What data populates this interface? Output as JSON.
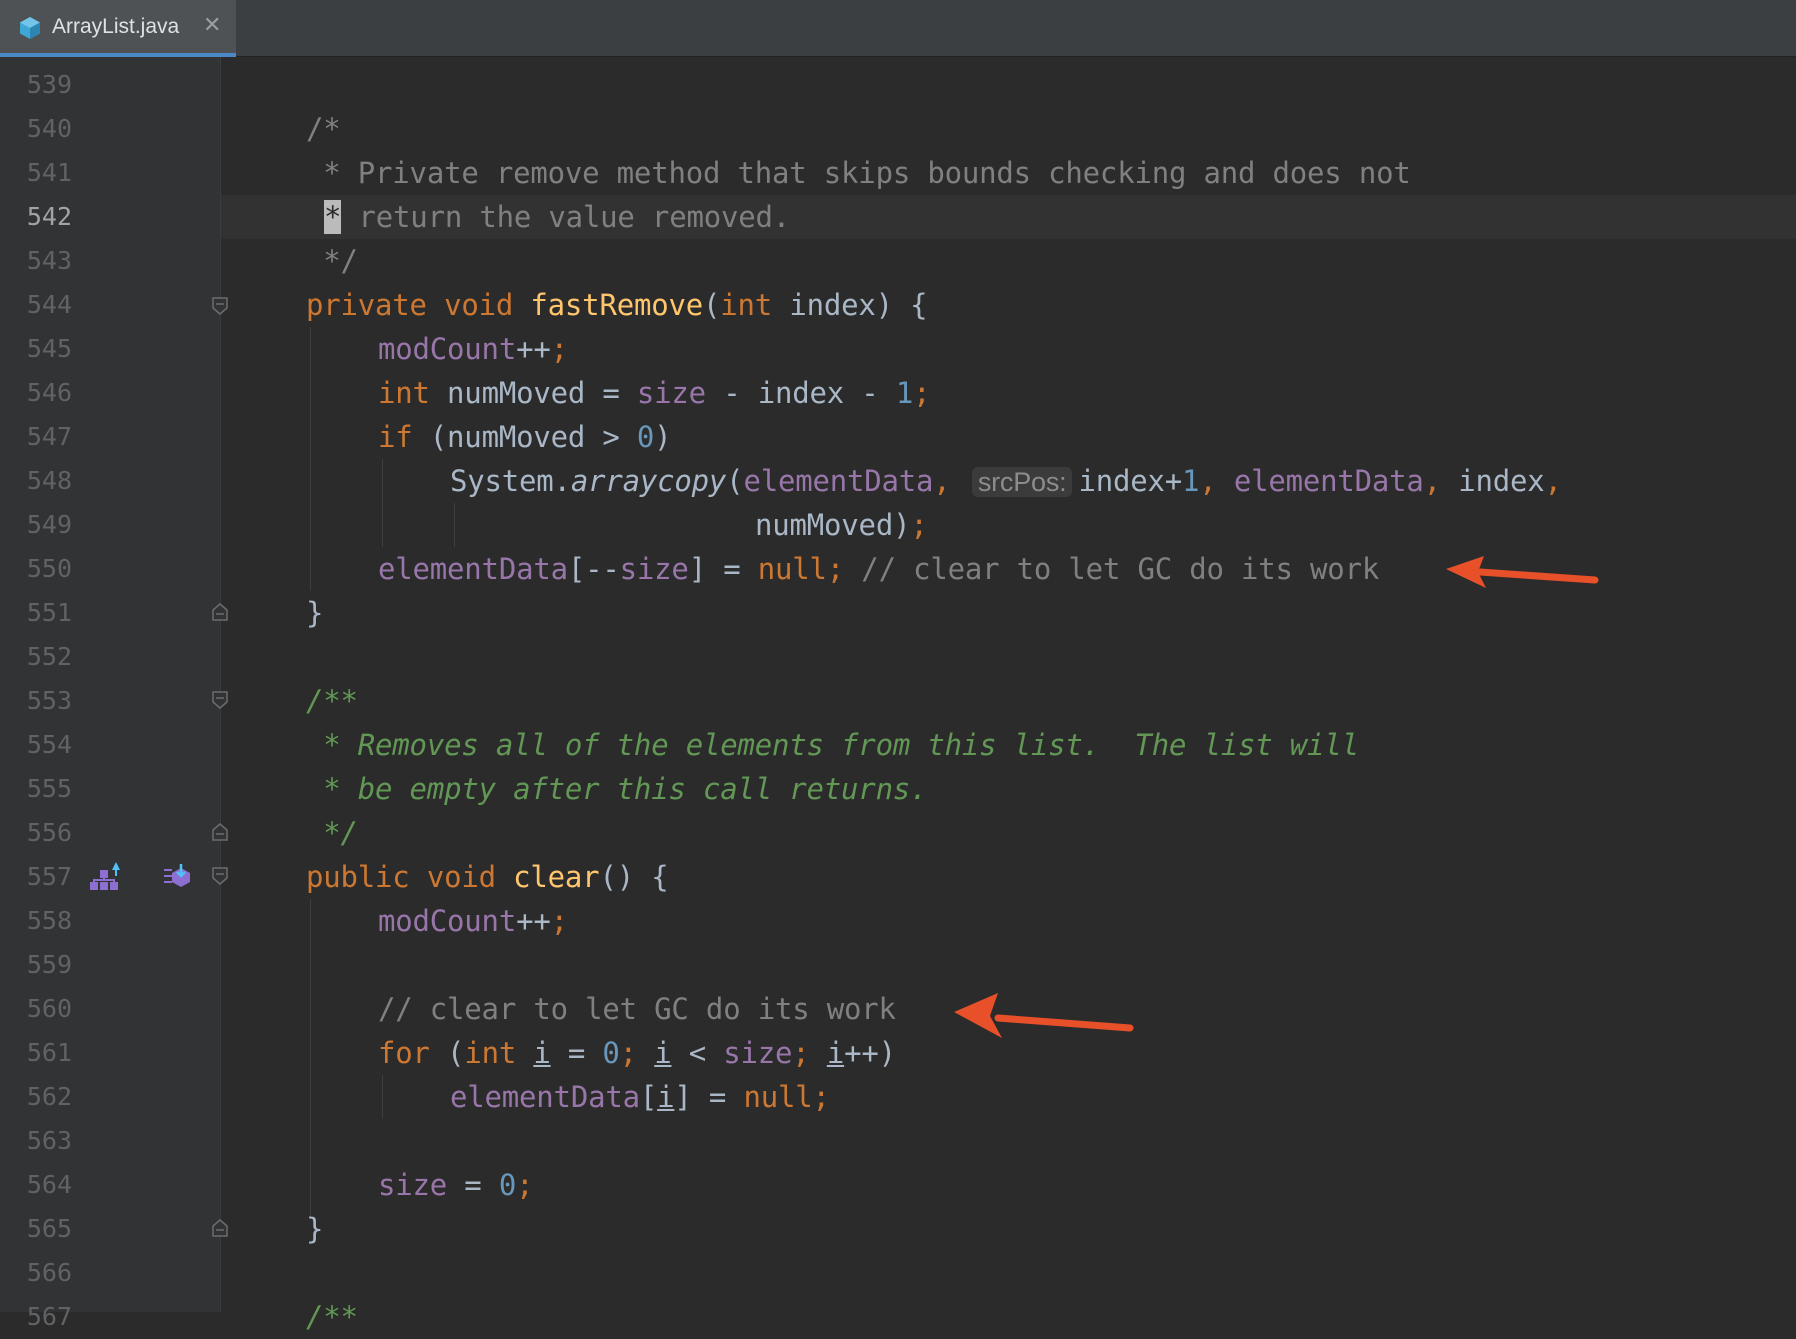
{
  "tab": {
    "title": "ArrayList.java",
    "close": "✕",
    "icon": "java-class-icon"
  },
  "lines": [
    {
      "n": "539",
      "current": false
    },
    {
      "n": "540",
      "current": false
    },
    {
      "n": "541",
      "current": false
    },
    {
      "n": "542",
      "current": true
    },
    {
      "n": "543",
      "current": false
    },
    {
      "n": "544",
      "current": false
    },
    {
      "n": "545",
      "current": false
    },
    {
      "n": "546",
      "current": false
    },
    {
      "n": "547",
      "current": false
    },
    {
      "n": "548",
      "current": false
    },
    {
      "n": "549",
      "current": false
    },
    {
      "n": "550",
      "current": false
    },
    {
      "n": "551",
      "current": false
    },
    {
      "n": "552",
      "current": false
    },
    {
      "n": "553",
      "current": false
    },
    {
      "n": "554",
      "current": false
    },
    {
      "n": "555",
      "current": false
    },
    {
      "n": "556",
      "current": false
    },
    {
      "n": "557",
      "current": false
    },
    {
      "n": "558",
      "current": false
    },
    {
      "n": "559",
      "current": false
    },
    {
      "n": "560",
      "current": false
    },
    {
      "n": "561",
      "current": false
    },
    {
      "n": "562",
      "current": false
    },
    {
      "n": "563",
      "current": false
    },
    {
      "n": "564",
      "current": false
    },
    {
      "n": "565",
      "current": false
    },
    {
      "n": "566",
      "current": false
    },
    {
      "n": "567",
      "current": false
    }
  ],
  "code": {
    "l540": "/*",
    "l541": " * Private remove method that skips bounds checking and does not",
    "l542a": "*",
    "l542b": " return the value removed.",
    "l543": " */",
    "private": "private",
    "void": "void",
    "fastRemove": "fastRemove",
    "paren_open": "(",
    "int": "int",
    "index": "index",
    "sig_end": ") {",
    "modCount": "modCount",
    "plusplus": "++",
    "semi": ";",
    "numMoved": "numMoved",
    "eq": " = ",
    "size": "size",
    "minus": " - ",
    "one": "1",
    "if": "if",
    "if_open": " (numMoved > ",
    "zero": "0",
    "close_paren": ")",
    "system": "System.",
    "arraycopy": "arraycopy",
    "elementData": "elementData",
    "comma": ",",
    "hint_srcPos": "srcPos:",
    "index_plus": "index+",
    "numMoved_close": "numMoved)",
    "l550_dec": "[--",
    "l550_br": "]",
    "null": "null",
    "l550_comment": " // clear to let GC do its work",
    "brace_close": "}",
    "l553": "/**",
    "l554": " * Removes all of the elements from this list.  The list will",
    "l555": " * be empty after this call returns.",
    "l556": " */",
    "public": "public",
    "clear": "clear",
    "clear_sig": "() {",
    "l560": "// clear to let GC do its work",
    "for": "for",
    "i": "i",
    "lt": " < ",
    "for_end": "++)",
    "l567": "/**"
  },
  "colors": {
    "keyword": "#cc7832",
    "function": "#ffc66d",
    "field": "#9876aa",
    "number": "#6897bb",
    "comment": "#808080",
    "doc": "#629755",
    "arrow": "#e8502a"
  },
  "gutter_icons": [
    "hierarchy-icon",
    "overrides-icon"
  ]
}
